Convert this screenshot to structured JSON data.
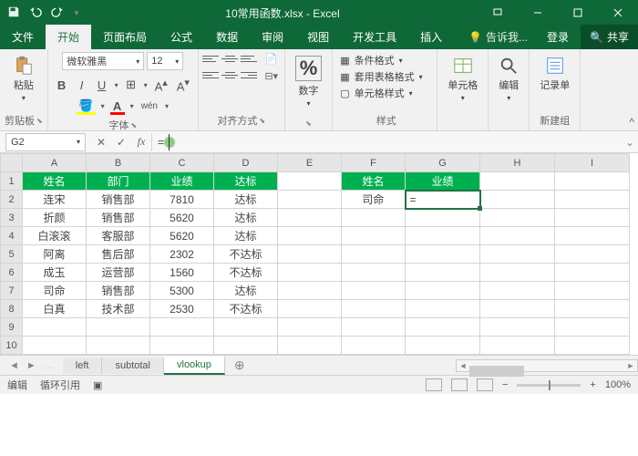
{
  "title": "10常用函数.xlsx - Excel",
  "tabs": {
    "file": "文件",
    "home": "开始",
    "layout": "页面布局",
    "formulas": "公式",
    "data": "数据",
    "review": "审阅",
    "view": "视图",
    "dev": "开发工具",
    "insert": "插入",
    "tellme": "告诉我...",
    "login": "登录",
    "share": "共享"
  },
  "ribbon": {
    "clipboard": {
      "paste": "粘贴",
      "label": "剪贴板"
    },
    "font": {
      "name": "微软雅黑",
      "size": "12",
      "label": "字体"
    },
    "align": {
      "label": "对齐方式"
    },
    "number": {
      "btn": "数字",
      "label": "%"
    },
    "styles": {
      "cond": "条件格式",
      "table": "套用表格格式",
      "cell": "单元格样式",
      "label": "样式"
    },
    "cells": {
      "label": "单元格"
    },
    "editing": {
      "label": "编辑"
    },
    "record": {
      "btn": "记录单",
      "label": "新建组"
    }
  },
  "formula_bar": {
    "cell_ref": "G2",
    "value": "="
  },
  "columns": [
    "A",
    "B",
    "C",
    "D",
    "E",
    "F",
    "G",
    "H",
    "I"
  ],
  "headers_left": {
    "name": "姓名",
    "dept": "部门",
    "perf": "业绩",
    "status": "达标"
  },
  "headers_right": {
    "name": "姓名",
    "perf": "业绩"
  },
  "rows": [
    {
      "name": "连宋",
      "dept": "销售部",
      "perf": "7810",
      "status": "达标"
    },
    {
      "name": "折颜",
      "dept": "销售部",
      "perf": "5620",
      "status": "达标"
    },
    {
      "name": "白滚滚",
      "dept": "客服部",
      "perf": "5620",
      "status": "达标"
    },
    {
      "name": "阿离",
      "dept": "售后部",
      "perf": "2302",
      "status": "不达标"
    },
    {
      "name": "成玉",
      "dept": "运营部",
      "perf": "1560",
      "status": "不达标"
    },
    {
      "name": "司命",
      "dept": "销售部",
      "perf": "5300",
      "status": "达标"
    },
    {
      "name": "白真",
      "dept": "技术部",
      "perf": "2530",
      "status": "不达标"
    }
  ],
  "lookup": {
    "name": "司命",
    "formula": "="
  },
  "sheets": {
    "s1": "left",
    "s2": "subtotal",
    "s3": "vlookup"
  },
  "status": {
    "mode": "编辑",
    "circ": "循环引用",
    "zoom": "100%"
  }
}
